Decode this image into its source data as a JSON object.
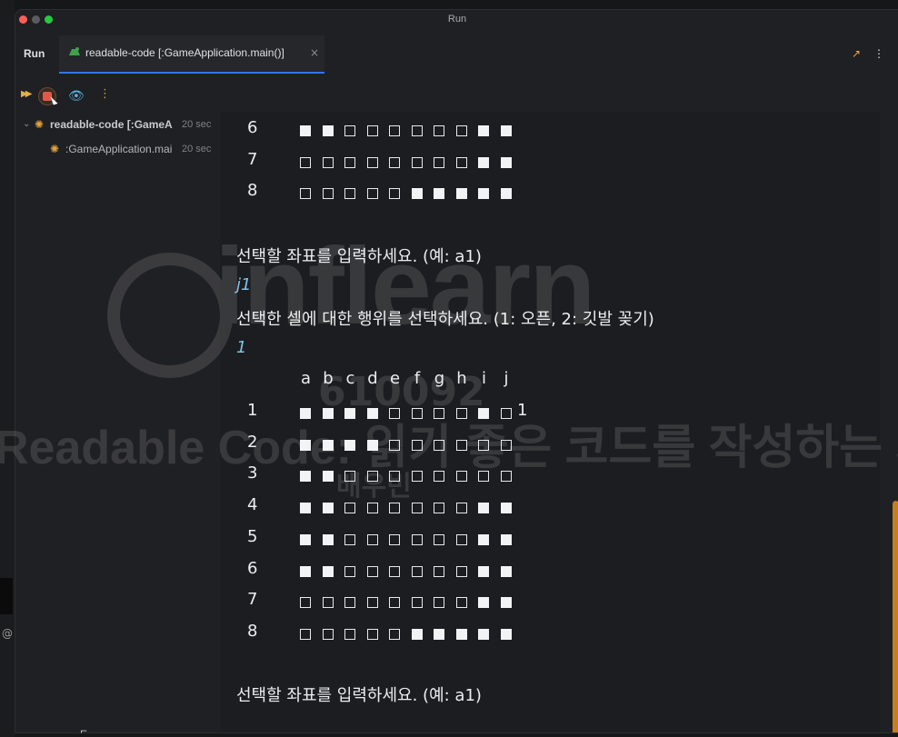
{
  "window": {
    "title": "Run"
  },
  "tabbar": {
    "run_label": "Run",
    "tab_label": "readable-code [:GameApplication.main()]",
    "tab_close": "×",
    "arrow_icon": "↗",
    "more_icon": "⋮"
  },
  "toolbar": {
    "eye_icon": "👁",
    "more_icon": "⋮"
  },
  "tree": {
    "root_label": "readable-code [:GameA",
    "root_time": "20 sec",
    "child_label": ":GameApplication.mai",
    "child_time": "20 sec"
  },
  "console": {
    "prompt_coord": "선택할 좌표를 입력하세요. (예: a1)",
    "input_coord": "j1",
    "prompt_action": "선택한 셀에 대한 행위를 선택하세요. (1: 오픈, 2: 깃발 꽂기)",
    "input_action": "1",
    "prompt_coord_2": "선택할 좌표를 입력하세요. (예: a1)",
    "column_headers": [
      "a",
      "b",
      "c",
      "d",
      "e",
      "f",
      "g",
      "h",
      "i",
      "j"
    ],
    "top_board_rows": [
      {
        "label": "6",
        "cells": "FFOOOOOOFF"
      },
      {
        "label": "7",
        "cells": "OOOOOOOOFF"
      },
      {
        "label": "8",
        "cells": "OOOOOFFFFF"
      }
    ],
    "board_rows": [
      {
        "label": "1",
        "cells": "FFFFOOOOFO",
        "tail": "1"
      },
      {
        "label": "2",
        "cells": "FFFFOOOOOO",
        "tail": ""
      },
      {
        "label": "3",
        "cells": "FFOOOOOOOO",
        "tail": ""
      },
      {
        "label": "4",
        "cells": "FFOOOOOOFF",
        "tail": ""
      },
      {
        "label": "5",
        "cells": "FFOOOOOOFF",
        "tail": ""
      },
      {
        "label": "6",
        "cells": "FFOOOOOOFF",
        "tail": ""
      },
      {
        "label": "7",
        "cells": "OOOOOOOOFF",
        "tail": ""
      },
      {
        "label": "8",
        "cells": "OOOOOFFFFF",
        "tail": ""
      }
    ]
  },
  "watermark": {
    "brand": "inflearn",
    "id": "610092",
    "course": "Readable Code: 읽기 좋은 코드를 작성하는 사고법",
    "sub": "배우빈"
  },
  "colors": {
    "accent": "#3574f0",
    "warning": "#c47f1e",
    "input_text": "#7ec3e8"
  }
}
